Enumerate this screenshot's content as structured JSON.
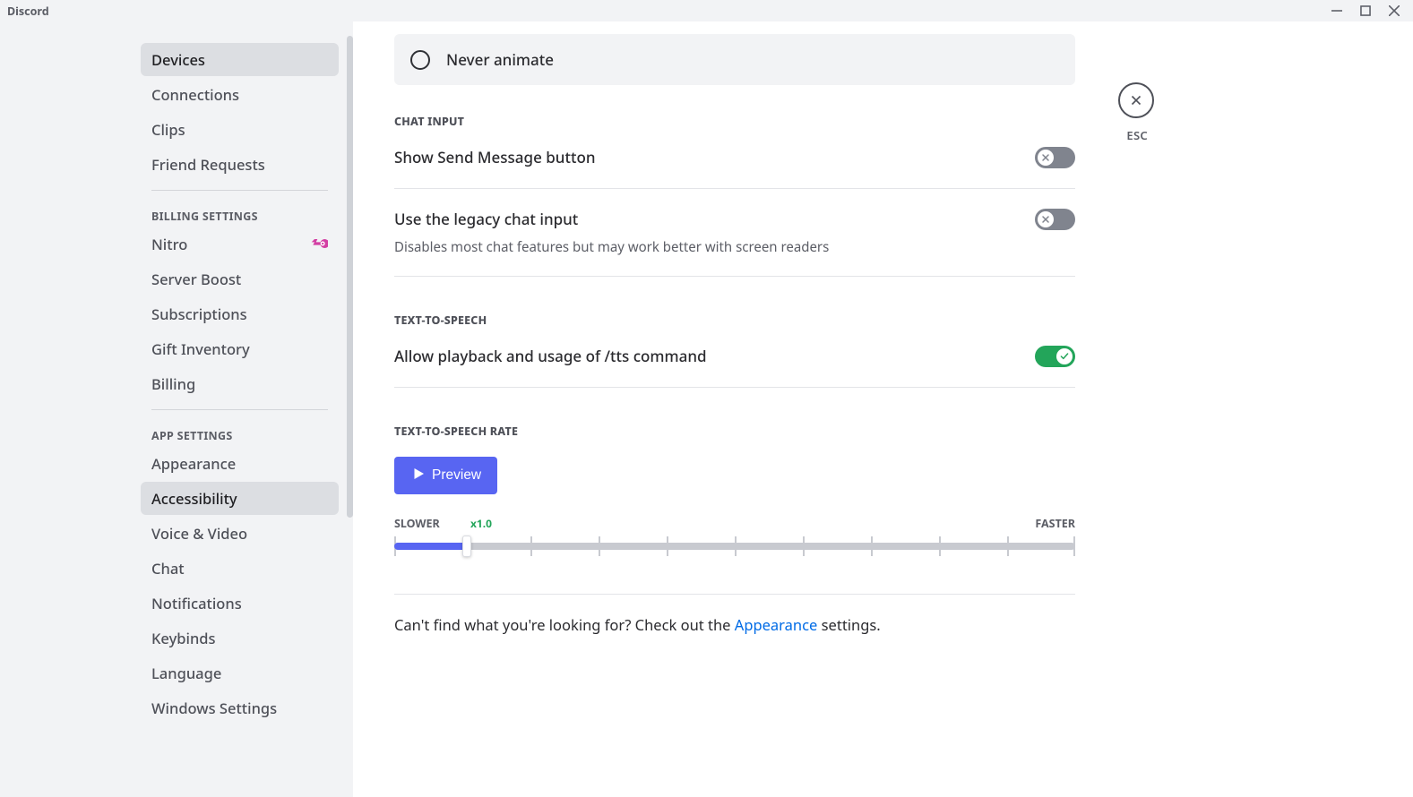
{
  "titlebar": {
    "app_name": "Discord"
  },
  "sidebar": {
    "items_user": [
      {
        "label": "Devices"
      },
      {
        "label": "Connections"
      },
      {
        "label": "Clips"
      },
      {
        "label": "Friend Requests"
      }
    ],
    "header_billing": "BILLING SETTINGS",
    "items_billing": [
      {
        "label": "Nitro",
        "has_badge": true
      },
      {
        "label": "Server Boost"
      },
      {
        "label": "Subscriptions"
      },
      {
        "label": "Gift Inventory"
      },
      {
        "label": "Billing"
      }
    ],
    "header_app": "APP SETTINGS",
    "items_app": [
      {
        "label": "Appearance"
      },
      {
        "label": "Accessibility",
        "selected": true
      },
      {
        "label": "Voice & Video"
      },
      {
        "label": "Chat"
      },
      {
        "label": "Notifications"
      },
      {
        "label": "Keybinds"
      },
      {
        "label": "Language"
      },
      {
        "label": "Windows Settings"
      }
    ]
  },
  "content": {
    "radio_never_animate": "Never animate",
    "section_chat_input": "CHAT INPUT",
    "show_send_btn": {
      "title": "Show Send Message button",
      "value": false
    },
    "legacy_input": {
      "title": "Use the legacy chat input",
      "desc": "Disables most chat features but may work better with screen readers",
      "value": false
    },
    "section_tts": "TEXT-TO-SPEECH",
    "allow_tts": {
      "title": "Allow playback and usage of /tts command",
      "value": true
    },
    "section_tts_rate": "TEXT-TO-SPEECH RATE",
    "preview_label": "Preview",
    "slider": {
      "slower": "SLOWER",
      "faster": "FASTER",
      "mark": "x1.0",
      "fill_percent": 10.5
    },
    "footer_pre": "Can't find what you're looking for? Check out the ",
    "footer_link": "Appearance",
    "footer_post": " settings."
  },
  "close": {
    "esc": "ESC"
  }
}
